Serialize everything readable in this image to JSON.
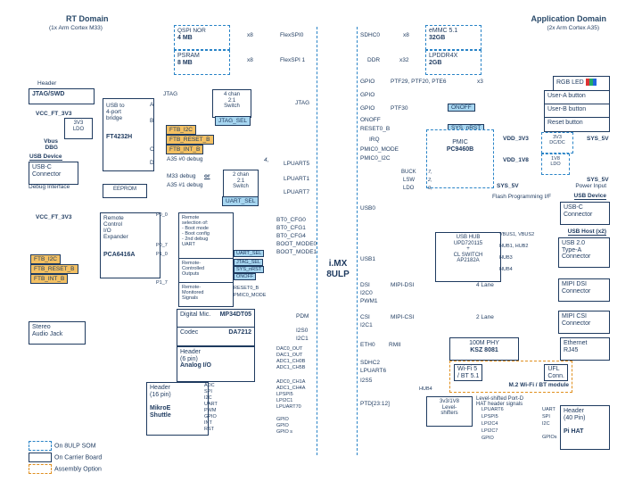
{
  "headers": {
    "rt_title": "RT Domain",
    "rt_sub": "(1x Arm Cortex M33)",
    "app_title": "Application Domain",
    "app_sub": "(2x Arm Cortex A35)"
  },
  "center": {
    "chip": "i.MX\n8ULP"
  },
  "legend": {
    "l1": "On 8ULP SOM",
    "l2": "On Carrier Board",
    "l3": "Assembly Option"
  },
  "top_mem": {
    "qspi_title": "QSPI NOR",
    "qspi_size": "4 MB",
    "psram_title": "PSRAM",
    "psram_size": "8 MB",
    "bus1": "x8",
    "if1": "FlexSPI0",
    "bus2": "x8",
    "if2": "FlexSPI 1",
    "sdhc0": "SDHC0",
    "x8": "x8",
    "emmc_title": "eMMC 5.1",
    "emmc_size": "32GB",
    "ddr": "DDR",
    "x32": "x32",
    "lpddr_title": "LPDDR4X",
    "lpddr_size": "2GB"
  },
  "left": {
    "header_lbl": "Header",
    "jtag": "JTAG/SWD",
    "vcc1": "VCC_FT_3V3",
    "ldo1": "3V3\nLDO",
    "vbus": "Vbus\nDBG",
    "usbdev": "USB Device",
    "usbc": "USB-C\nConnector",
    "dbgif": "Debug Interface",
    "bridge_top": "USB to\n4-port\nbridge",
    "bridge_chip": "FT4232H",
    "ad": [
      "A",
      "B",
      "C",
      "D"
    ],
    "eeprom": "EEPROM",
    "sw_title": "4 chan\n2:1\nSwitch",
    "jtag_sel": "JTAG_SEL",
    "ftb_i2c": "FTB_I2C",
    "ftb_reset": "FTB_RESET_B",
    "ftb_int": "FTB_INT_B",
    "a35": "A35 #0 debug",
    "m33": "M33 debug",
    "or": "or",
    "a351": "A35 #1 debug",
    "sw2_title": "2 chan\n2:1\nSwitch",
    "uart_sel": "UART_SEL",
    "lpuart5": "LPUART5",
    "lpuart1": "LPUART1",
    "lpuart7": "LPUART7",
    "jtag_if": "JTAG",
    "four": "4,"
  },
  "expander": {
    "vcc": "VCC_FT_3V3",
    "title": "Remote\nControl\nI/O\nExpander",
    "chip": "PCA6416A",
    "p00": "P0_0",
    "p07": "P0_7",
    "p10": "P1_0",
    "p17": "P1_7",
    "sel_box": "Remote\nselection of:\n- Boot mode\n- Boot config\n- 2nd debug\nUART",
    "ctrl_box": "Remote-\nControlled\nOutputs",
    "mon_box": "Remote-\nMonitored\nSignals",
    "jtag_sel": "JTAG_SEL",
    "sys_nrst": "SYS_nRST",
    "onoff": "ONOFF",
    "uart_sel": "UART_SEL",
    "reset0_b": "RESET0_B",
    "pmic_mode": "PMIC0_MODE",
    "bt0": "BT0_CFG0",
    "bt1": "BT0_CFG1",
    "bt4": "BT0_CFG4",
    "bm0": "BOOT_MODE0",
    "bm1": "BOOT_MODE1",
    "ftb_i2c": "FTB_I2C",
    "ftb_reset": "FTB_RESET_B",
    "ftb_int": "FTB_INT_B"
  },
  "audio": {
    "jack": "Stereo\nAudio Jack",
    "dm_title": "Digital Mic.",
    "dm_chip": "MP34DT05",
    "dm_if": "PDM",
    "codec_title": "Codec",
    "codec_chip": "DA7212",
    "codec_if1": "I2S0",
    "codec_if2": "I2C1",
    "ana_title": "Header\n(6 pin)",
    "ana_sub": "Analog I/O",
    "ana": [
      "DAC0_OUT",
      "DAC1_OUT",
      "ADC1_CH0B",
      "ADC1_CH5B",
      "ADC0_CH1A"
    ],
    "mik_title": "Header\n(16 pin)",
    "mik_sub": "MikroE\nShuttle",
    "mik": [
      "ADC",
      "SPI",
      "I2C",
      "UART",
      "PWM",
      "GPIO",
      "INT",
      "RST"
    ],
    "mik_if": [
      "ADC1_CH4A",
      "LPSPI5",
      "LPI2C1",
      "LPUART70",
      "GPIO",
      "GPIO",
      "GPIO s"
    ]
  },
  "center_if": {
    "gpio": "GPIO",
    "ptf29": "PTF29, PTF20, PTE6",
    "x3": "x3",
    "ptf30": "PTF30",
    "onoff": "ONOFF",
    "onoff_chip": "ONOFF",
    "reset0": "RESET0_B",
    "sys_nrst": "SYS_nRST",
    "irq": "IRQ",
    "pmic0_mode": "PMIC0_MODE",
    "pmic0_i2c": "PMIC0_I2C",
    "usb0": "USB0",
    "usb1": "USB1",
    "dsi": "DSI",
    "i2c0": "I2C0",
    "pwm1": "PWM1",
    "csi": "CSI",
    "i2c1": "I2C1",
    "eth0": "ETH0",
    "rmii": "RMII",
    "sdhc2": "SDHC2",
    "lpuart6": "LPUART6",
    "i2s5": "I2S5",
    "ptd": "PTD[23:12]"
  },
  "right": {
    "rgb": "RGB   LED",
    "ua": "User-A button",
    "ub": "User-B button",
    "rst": "Reset button",
    "pmic_title": "PMIC",
    "pmic_chip": "PC9460B",
    "pmic_buck": "BUCK",
    "pmic_lsw": "LSW",
    "pmic_ldo": "LDO",
    "pmic_7": "7,",
    "pmic_2": "2,",
    "pmic_9": "9,",
    "v3v3": "VDD_3V3",
    "dcdc": "3V3\nDC/DC",
    "sys5v": "SYS_5V",
    "v1v8": "VDD_1V8",
    "ldo1v8": "1V8\nLDO",
    "pwr": "Power Input",
    "flash": "Flash Programming I/F",
    "usbdev": "USB Device",
    "usbc": "USB-C\nConnector",
    "hub_title": "USB HUB\nUPD720115\n+\nCL SWITCH\nAP2182A",
    "vbus": "VBUS1, VBUS2",
    "hub12": "HUB1, HUB2",
    "hub3": "HUB3",
    "hub4": "HUB4",
    "usbhost": "USB Host (x2)",
    "usb20": "USB 2.0\nType-A\nConnector",
    "mipi_dsi": "MIPI-DSI",
    "lanes4": "4 Lane",
    "mipi_dsi_conn": "MIPI DSI\nConnector",
    "mipi_csi": "MIPI-CSI",
    "lanes2": "2 Lane",
    "mipi_csi_conn": "MIPI CSI\nConnector",
    "phy": "100M PHY",
    "phy_chip": "KSZ 8081",
    "eth": "Ethernet\nRJ45",
    "wifi": "Wi-Fi 5\n/ BT 5.1",
    "ufl": "UFL\nConn.",
    "m2": "M.2 Wi-Fi / BT module",
    "lvl": "3v3/1V8\nLevel-\nshifters",
    "lvl_note": "Level-shifted Port-D\nHAT header signals",
    "hdr40": "Header\n(40 Pin)",
    "pihat": "Pi HAT",
    "hat": [
      "UART",
      "SPI",
      "I2C",
      "GPIOs"
    ],
    "hat_l": [
      "LPUART6",
      "LPSPI5",
      "LPI2C4",
      "LPI2C7",
      "GPIO"
    ]
  }
}
